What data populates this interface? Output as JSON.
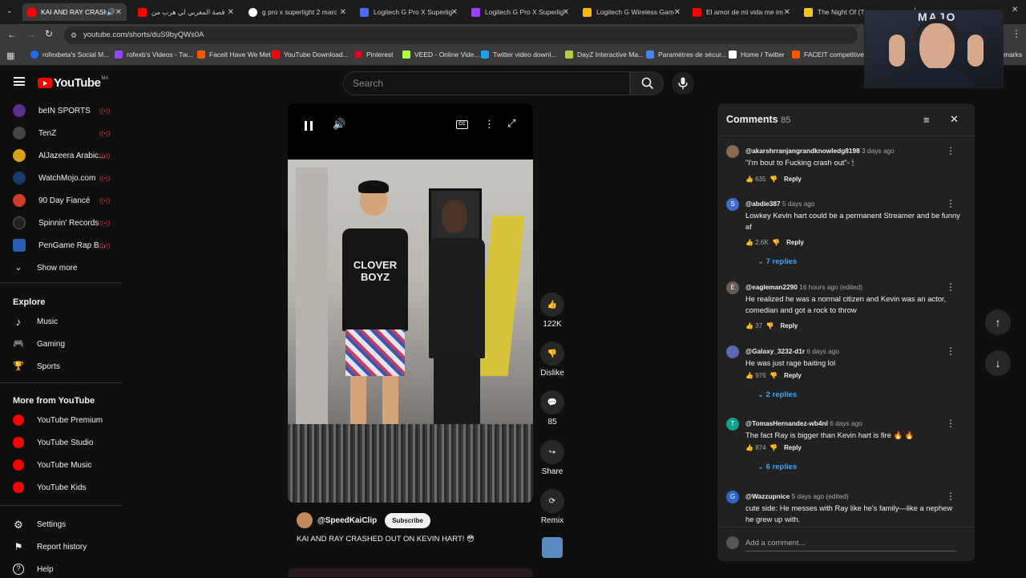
{
  "tabs": [
    {
      "title": "KAI AND RAY CRASHE",
      "color": "#ff0000",
      "active": true
    },
    {
      "title": "قصة المغربي لي هرب من",
      "color": "#ff0000"
    },
    {
      "title": "g pro x superlight 2 marc",
      "color": "#ffffff"
    },
    {
      "title": "Logitech G Pro X Superlig",
      "color": "#4e6bff"
    },
    {
      "title": "Logitech G Pro X Superlig",
      "color": "#a040ff"
    },
    {
      "title": "Logitech G Wireless Gam",
      "color": "#ffb800"
    },
    {
      "title": "El amor de mi vida me im",
      "color": "#ff0000"
    },
    {
      "title": "The Night Of (TV Mini S",
      "color": "#f5c518"
    }
  ],
  "address": {
    "url": "youtube.com/shorts/duS9byQWs0A"
  },
  "bookmarks": [
    {
      "label": "rofexbeta's Social M...",
      "color": "#1e6cff"
    },
    {
      "label": "rofexb's Videos - Tw...",
      "color": "#9146ff"
    },
    {
      "label": "Faceit Have We Met",
      "color": "#ff5500"
    },
    {
      "label": "YouTube Download...",
      "color": "#ff0000"
    },
    {
      "label": "Pinterest",
      "color": "#e60023"
    },
    {
      "label": "VEED - Online Vide...",
      "color": "#b4ff3c"
    },
    {
      "label": "Twitter video downl...",
      "color": "#1da1f2"
    },
    {
      "label": "DayZ Interactive Ma...",
      "color": "#b0d040"
    },
    {
      "label": "Paramètres de sécur...",
      "color": "#4285f4"
    },
    {
      "label": "Home / Twitter",
      "color": "#ffffff"
    },
    {
      "label": "FACEIT competitive...",
      "color": "#ff5500"
    },
    {
      "label": "marks",
      "color": ""
    }
  ],
  "youtube": {
    "logo": "YouTube",
    "country": "MA",
    "search_placeholder": "Search",
    "subscriptions": [
      {
        "name": "beIN SPORTS",
        "color": "#5b2d8e"
      },
      {
        "name": "TenZ",
        "color": "#444444"
      },
      {
        "name": "AlJazeera Arabic...",
        "color": "#d6a21a"
      },
      {
        "name": "WatchMojo.com",
        "color": "#1a3b6e"
      },
      {
        "name": "90 Day Fiancé",
        "color": "#d43c2a"
      },
      {
        "name": "Spinnin' Records",
        "color": "#222222"
      },
      {
        "name": "PenGame Rap B...",
        "color": "#2a5fb4"
      }
    ],
    "show_more": "Show more",
    "explore_title": "Explore",
    "explore": [
      "Music",
      "Gaming",
      "Sports"
    ],
    "more_title": "More from YouTube",
    "more": [
      "YouTube Premium",
      "YouTube Studio",
      "YouTube Music",
      "YouTube Kids"
    ],
    "footer": [
      "Settings",
      "Report history",
      "Help"
    ]
  },
  "video": {
    "channel": "@SpeedKaiClip",
    "subscribe": "Subscribe",
    "title": "KAI AND RAY CRASHED OUT ON KEVIN HART! 😳",
    "shirt_text": "CLOVER BOYZ",
    "likes": "122K",
    "dislike": "Dislike",
    "comments_count": "85",
    "share": "Share",
    "remix": "Remix"
  },
  "comments_panel": {
    "title": "Comments",
    "count": "85",
    "add_placeholder": "Add a comment...",
    "comments": [
      {
        "author": "@akarshrranjangrandknowledg8198",
        "age": "3 days ago",
        "text": "\"I'm bout to Fucking crash out\"- 🕯",
        "likes": "635",
        "avatar": "",
        "avatar_color": "#8a6a50",
        "replies": ""
      },
      {
        "author": "@abdie387",
        "age": "5 days ago",
        "text": "Lowkey Kevin hart could be a permanent Streamer and be funny af",
        "likes": "2.6K",
        "avatar": "S",
        "avatar_color": "#3f6bc9",
        "replies": "7 replies"
      },
      {
        "author": "@eagleman2290",
        "age": "16 hours ago (edited)",
        "text": "He realized he was a normal citizen and Kevin was an actor, comedian and got a rock to throw",
        "likes": "37",
        "avatar": "E",
        "avatar_color": "#6a5a52",
        "replies": ""
      },
      {
        "author": "@Galaxy_3232-d1r",
        "age": "6 days ago",
        "text": "He was just rage baiting lol",
        "likes": "976",
        "avatar": "",
        "avatar_color": "#5a6ab0",
        "replies": "2 replies"
      },
      {
        "author": "@TomasHernandez-wb4nl",
        "age": "6 days ago",
        "text": "The fact Ray is bigger than Kevin hart is fire 🔥 🔥",
        "likes": "874",
        "avatar": "T",
        "avatar_color": "#12a08a",
        "replies": "6 replies"
      },
      {
        "author": "@Wazzupnice",
        "age": "5 days ago (edited)",
        "text": "cute side: He messes with Ray like he's family—like a nephew he grew up with.",
        "likes": "",
        "avatar": "G",
        "avatar_color": "#2e63c7",
        "replies": ""
      }
    ],
    "reply_label": "Reply"
  },
  "webcam_overlay": {
    "text": "MAJO"
  }
}
